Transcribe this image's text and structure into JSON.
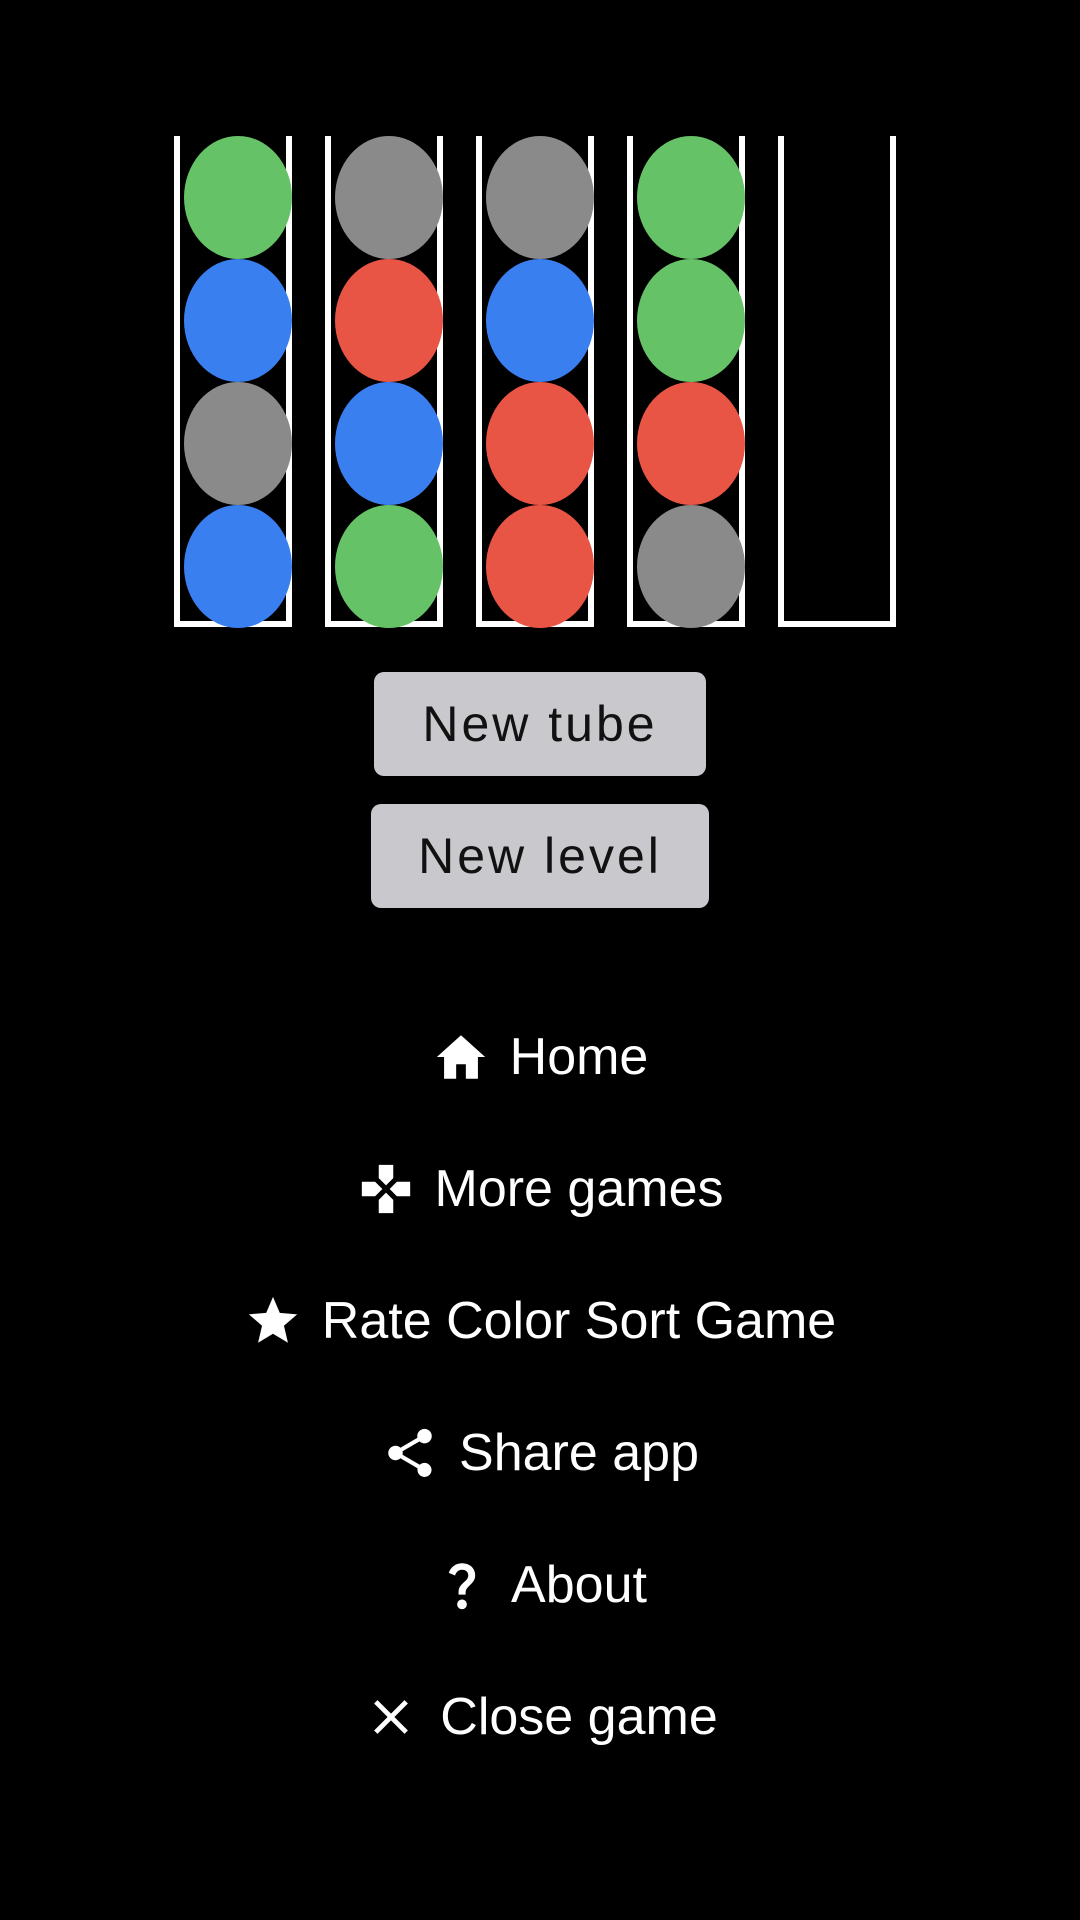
{
  "tubes": [
    {
      "balls": [
        "green",
        "blue",
        "gray",
        "blue"
      ]
    },
    {
      "balls": [
        "gray",
        "red",
        "blue",
        "green"
      ]
    },
    {
      "balls": [
        "gray",
        "blue",
        "red",
        "red"
      ]
    },
    {
      "balls": [
        "green",
        "green",
        "red",
        "gray"
      ]
    },
    {
      "balls": []
    }
  ],
  "colors": {
    "green": "#66c266",
    "blue": "#3a7ff0",
    "gray": "#8a8a8a",
    "red": "#e85545",
    "tube_border": "#ffffff",
    "button_bg": "#c9c8cc",
    "background": "#000000"
  },
  "buttons": {
    "new_tube": "New tube",
    "new_level": "New level"
  },
  "menu": {
    "home": {
      "label": "Home",
      "icon": "home-icon"
    },
    "more_games": {
      "label": "More games",
      "icon": "gamepad-icon"
    },
    "rate": {
      "label": "Rate Color Sort Game",
      "icon": "star-icon"
    },
    "share": {
      "label": "Share app",
      "icon": "share-icon"
    },
    "about": {
      "label": "About",
      "icon": "question-icon"
    },
    "close": {
      "label": "Close game",
      "icon": "close-icon"
    }
  }
}
